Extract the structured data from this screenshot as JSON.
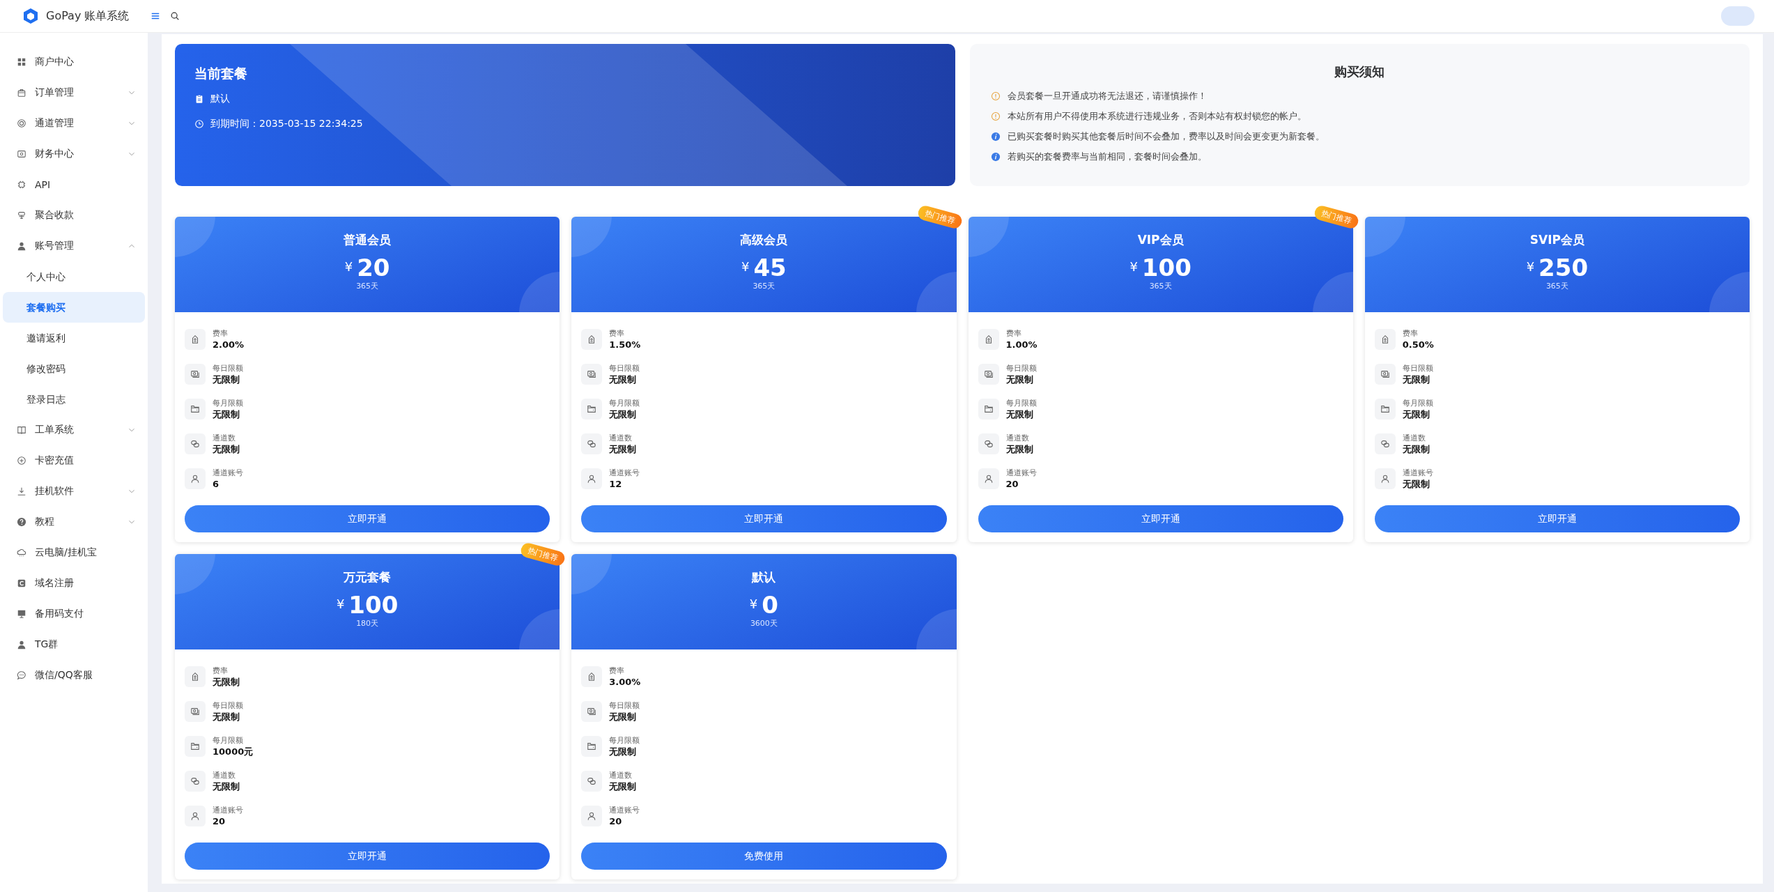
{
  "header": {
    "app_name": "GoPay 账单系统"
  },
  "sidebar": {
    "items": [
      {
        "label": "商户中心",
        "selected": false
      },
      {
        "label": "订单管理",
        "selected": false,
        "expanded": false
      },
      {
        "label": "通道管理",
        "selected": false,
        "expanded": false
      },
      {
        "label": "财务中心",
        "selected": false,
        "expanded": false
      },
      {
        "label": "API",
        "selected": false
      },
      {
        "label": "聚合收款",
        "selected": false
      },
      {
        "label": "账号管理",
        "selected": false,
        "expanded": true,
        "children": [
          {
            "label": "个人中心",
            "selected": false
          },
          {
            "label": "套餐购买",
            "selected": true
          },
          {
            "label": "邀请返利",
            "selected": false
          },
          {
            "label": "修改密码",
            "selected": false
          },
          {
            "label": "登录日志",
            "selected": false
          }
        ]
      },
      {
        "label": "工单系统",
        "selected": false,
        "expanded": false
      },
      {
        "label": "卡密充值",
        "selected": false
      },
      {
        "label": "挂机软件",
        "selected": false,
        "expanded": false
      },
      {
        "label": "教程",
        "selected": false,
        "expanded": false
      },
      {
        "label": "云电脑/挂机宝",
        "selected": false
      },
      {
        "label": "域名注册",
        "selected": false
      },
      {
        "label": "备用码支付",
        "selected": false
      },
      {
        "label": "TG群",
        "selected": false
      },
      {
        "label": "微信/QQ客服",
        "selected": false
      }
    ]
  },
  "current_plan": {
    "title": "当前套餐",
    "plan_name": "默认",
    "expiry": "到期时间：2035-03-15 22:34:25"
  },
  "notice": {
    "title": "购买须知",
    "items": [
      {
        "kind": "warning",
        "text": "会员套餐一旦开通成功将无法退还，请谨慎操作！"
      },
      {
        "kind": "warning",
        "text": "本站所有用户不得使用本系统进行违规业务，否则本站有权封锁您的帐户。"
      },
      {
        "kind": "info",
        "text": "已购买套餐时购买其他套餐后时间不会叠加，费率以及时间会更变更为新套餐。"
      },
      {
        "kind": "info",
        "text": "若购买的套餐费率与当前相同，套餐时间会叠加。"
      }
    ]
  },
  "plans": [
    {
      "name": "普通会员",
      "currency": "¥",
      "price": "20",
      "duration": "365天",
      "features": [
        {
          "label": "费率",
          "value": "2.00%"
        },
        {
          "label": "每日限额",
          "value": "无限制"
        },
        {
          "label": "每月限额",
          "value": "无限制"
        },
        {
          "label": "通道数",
          "value": "无限制"
        },
        {
          "label": "通道账号",
          "value": "6"
        }
      ],
      "button": "立即开通"
    },
    {
      "name": "高级会员",
      "currency": "¥",
      "price": "45",
      "duration": "365天",
      "badge": "热门推荐",
      "features": [
        {
          "label": "费率",
          "value": "1.50%"
        },
        {
          "label": "每日限额",
          "value": "无限制"
        },
        {
          "label": "每月限额",
          "value": "无限制"
        },
        {
          "label": "通道数",
          "value": "无限制"
        },
        {
          "label": "通道账号",
          "value": "12"
        }
      ],
      "button": "立即开通"
    },
    {
      "name": "VIP会员",
      "currency": "¥",
      "price": "100",
      "duration": "365天",
      "badge": "热门推荐",
      "features": [
        {
          "label": "费率",
          "value": "1.00%"
        },
        {
          "label": "每日限额",
          "value": "无限制"
        },
        {
          "label": "每月限额",
          "value": "无限制"
        },
        {
          "label": "通道数",
          "value": "无限制"
        },
        {
          "label": "通道账号",
          "value": "20"
        }
      ],
      "button": "立即开通"
    },
    {
      "name": "SVIP会员",
      "currency": "¥",
      "price": "250",
      "duration": "365天",
      "features": [
        {
          "label": "费率",
          "value": "0.50%"
        },
        {
          "label": "每日限额",
          "value": "无限制"
        },
        {
          "label": "每月限额",
          "value": "无限制"
        },
        {
          "label": "通道数",
          "value": "无限制"
        },
        {
          "label": "通道账号",
          "value": "无限制"
        }
      ],
      "button": "立即开通"
    },
    {
      "name": "万元套餐",
      "currency": "¥",
      "price": "100",
      "duration": "180天",
      "badge": "热门推荐",
      "features": [
        {
          "label": "费率",
          "value": "无限制"
        },
        {
          "label": "每日限额",
          "value": "无限制"
        },
        {
          "label": "每月限额",
          "value": "10000元"
        },
        {
          "label": "通道数",
          "value": "无限制"
        },
        {
          "label": "通道账号",
          "value": "20"
        }
      ],
      "button": "立即开通"
    },
    {
      "name": "默认",
      "currency": "¥",
      "price": "0",
      "duration": "3600天",
      "features": [
        {
          "label": "费率",
          "value": "3.00%"
        },
        {
          "label": "每日限额",
          "value": "无限制"
        },
        {
          "label": "每月限额",
          "value": "无限制"
        },
        {
          "label": "通道数",
          "value": "无限制"
        },
        {
          "label": "通道账号",
          "value": "20"
        }
      ],
      "button": "免费使用"
    }
  ]
}
